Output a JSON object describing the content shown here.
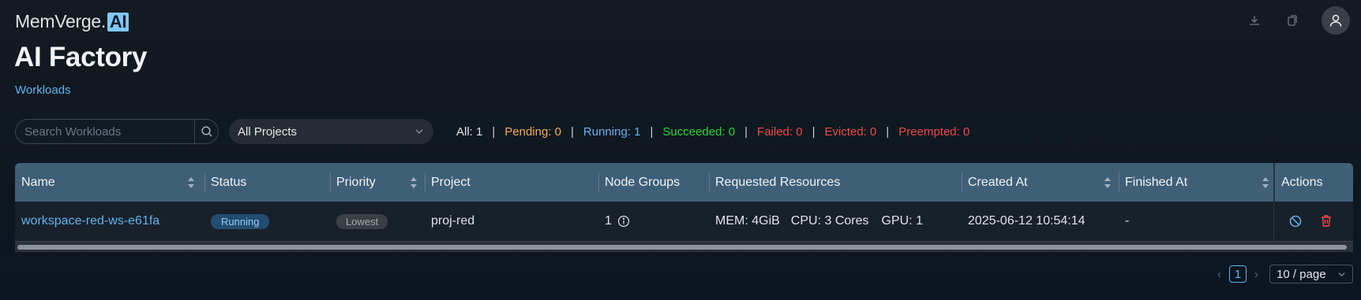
{
  "brand": {
    "name": "MemVerge.",
    "badge": "AI"
  },
  "header": {
    "icons": [
      "download-icon",
      "copy-icon",
      "user-icon"
    ]
  },
  "page": {
    "title": "AI Factory",
    "breadcrumb": "Workloads"
  },
  "toolbar": {
    "search_placeholder": "Search Workloads",
    "project_filter": "All Projects",
    "counts": [
      {
        "label": "All: 1",
        "color": "#e3e6ea"
      },
      {
        "label": "Pending: 0",
        "color": "#f3ac55"
      },
      {
        "label": "Running: 1",
        "color": "#69b5f2"
      },
      {
        "label": "Succeeded: 0",
        "color": "#2bd63c"
      },
      {
        "label": "Failed: 0",
        "color": "#ee4a4a"
      },
      {
        "label": "Evicted: 0",
        "color": "#ee4a4a"
      },
      {
        "label": "Preempted: 0",
        "color": "#ee4a4a"
      }
    ]
  },
  "table": {
    "columns": [
      "Name",
      "Status",
      "Priority",
      "Project",
      "Node Groups",
      "Requested Resources",
      "Created At",
      "Finished At",
      "Actions"
    ],
    "rows": [
      {
        "name": "workspace-red-ws-e61fa",
        "status": "Running",
        "priority": "Lowest",
        "project": "proj-red",
        "node_groups": "1",
        "mem": "MEM: 4GiB",
        "cpu": "CPU: 3 Cores",
        "gpu": "GPU: 1",
        "created_at": "2025-06-12 10:54:14",
        "finished_at": "-"
      }
    ]
  },
  "pagination": {
    "current_page": "1",
    "page_size": "10 / page"
  },
  "colors": {
    "accent": "#5fb4ef",
    "header_bg": "#3f5f77",
    "danger": "#ee4a4a"
  }
}
